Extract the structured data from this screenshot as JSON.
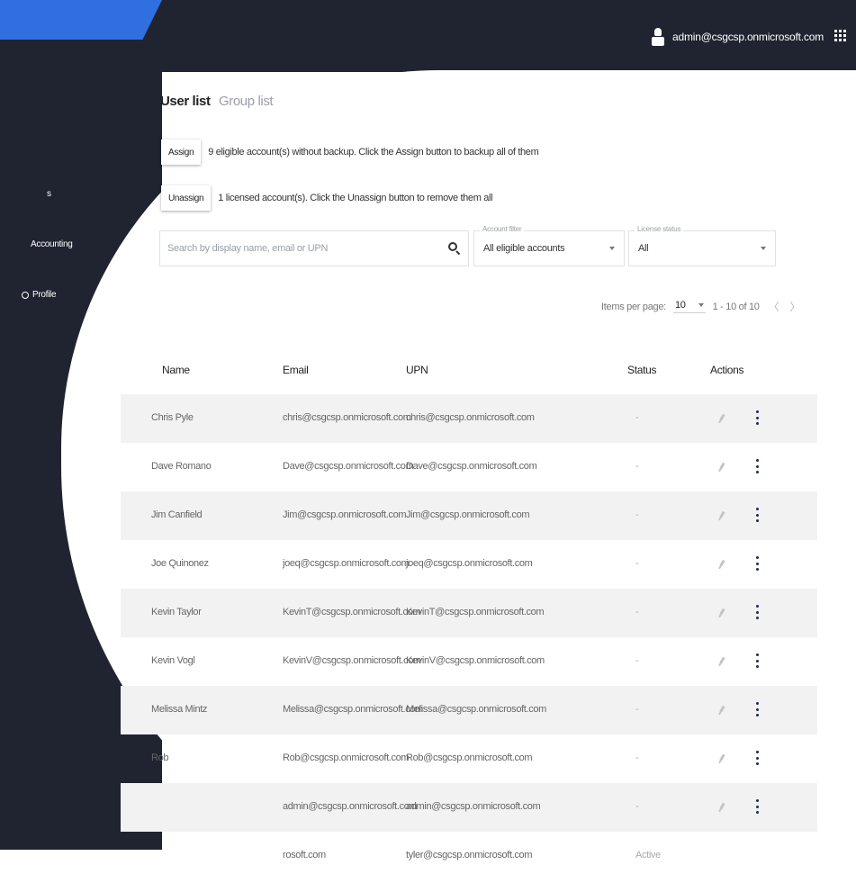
{
  "header": {
    "user_email": "admin@csgcsp.onmicrosoft.com",
    "user_icon": "user-icon",
    "apps_icon": "apps-grid-icon"
  },
  "sidebar": {
    "items": [
      {
        "label": "Accounting",
        "icon": "accounting-icon"
      },
      {
        "label": "Profile",
        "icon": "gear-icon"
      }
    ]
  },
  "tabs": [
    {
      "label": "User list",
      "active": true
    },
    {
      "label": "Group list",
      "active": false
    }
  ],
  "assign": {
    "button_label": "Assign",
    "message": "9 eligible account(s) without backup. Click the Assign button to backup all of them"
  },
  "unassign": {
    "button_label": "Unassign",
    "message": "1 licensed account(s). Click the Unassign button to remove them all"
  },
  "search": {
    "placeholder": "Search by display name, email or UPN",
    "value": ""
  },
  "account_filter": {
    "label": "Account filter",
    "value": "All eligible accounts"
  },
  "license_status": {
    "label": "License status",
    "value": "All"
  },
  "paginator": {
    "items_per_page_label": "Items per page:",
    "items_per_page": "10",
    "range": "1 - 10 of 10",
    "prev": "〈",
    "next": "〉"
  },
  "table": {
    "columns": [
      "Name",
      "Email",
      "UPN",
      "Status",
      "Actions"
    ],
    "rows": [
      {
        "name": "Chris Pyle",
        "email": "chris@csgcsp.onmicrosoft.com",
        "upn": "chris@csgcsp.onmicrosoft.com",
        "status": "-"
      },
      {
        "name": "Dave Romano",
        "email": "Dave@csgcsp.onmicrosoft.com",
        "upn": "Dave@csgcsp.onmicrosoft.com",
        "status": "-"
      },
      {
        "name": "Jim Canfield",
        "email": "Jim@csgcsp.onmicrosoft.com",
        "upn": "Jim@csgcsp.onmicrosoft.com",
        "status": "-"
      },
      {
        "name": "Joe Quinonez",
        "email": "joeq@csgcsp.onmicrosoft.com",
        "upn": "joeq@csgcsp.onmicrosoft.com",
        "status": "-"
      },
      {
        "name": "Kevin Taylor",
        "email": "KevinT@csgcsp.onmicrosoft.com",
        "upn": "KevinT@csgcsp.onmicrosoft.com",
        "status": "-"
      },
      {
        "name": "Kevin Vogl",
        "email": "KevinV@csgcsp.onmicrosoft.com",
        "upn": "KevinV@csgcsp.onmicrosoft.com",
        "status": "-"
      },
      {
        "name": "Melissa Mintz",
        "email": "Melissa@csgcsp.onmicrosoft.com",
        "upn": "Melissa@csgcsp.onmicrosoft.com",
        "status": "-"
      },
      {
        "name": "Rob",
        "email": "Rob@csgcsp.onmicrosoft.com",
        "upn": "Rob@csgcsp.onmicrosoft.com",
        "status": "-"
      },
      {
        "name": "",
        "email": "admin@csgcsp.onmicrosoft.com",
        "upn": "admin@csgcsp.onmicrosoft.com",
        "status": "-"
      },
      {
        "name": "",
        "email": "rosoft.com",
        "upn": "tyler@csgcsp.onmicrosoft.com",
        "status": "Active"
      }
    ]
  }
}
